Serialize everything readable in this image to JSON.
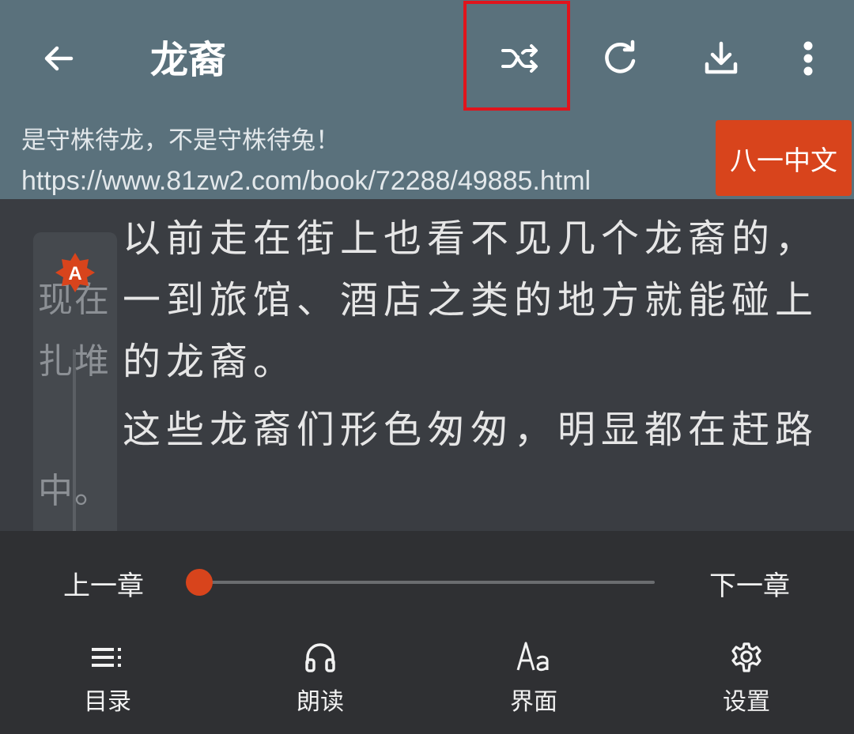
{
  "appbar": {
    "title": "龙裔",
    "back_icon": "arrow-left-icon",
    "actions": [
      "shuffle-icon",
      "refresh-icon",
      "download-icon",
      "more-vertical-icon"
    ]
  },
  "chapter": {
    "title": "是守株待龙，不是守株待兔！",
    "url": "https://www.81zw2.com/book/72288/49885.html",
    "source": "八一中文"
  },
  "reader": {
    "paragraphs": [
      "以前走在街上也看不见几个龙裔的，",
      "一到旅馆、酒店之类的地方就能碰上",
      "的龙裔。",
      "这些龙裔们形色匆匆，明显都在赶路"
    ],
    "side_lines": [
      "现在",
      "扎堆",
      "中。"
    ],
    "badge_letter": "A"
  },
  "progress": {
    "prev": "上一章",
    "next": "下一章",
    "value": 0
  },
  "menu": [
    {
      "label": "目录",
      "icon": "list-icon"
    },
    {
      "label": "朗读",
      "icon": "headphones-icon"
    },
    {
      "label": "界面",
      "icon": "font-icon"
    },
    {
      "label": "设置",
      "icon": "gear-icon"
    }
  ],
  "colors": {
    "appbar": "#5a717c",
    "accent": "#d8441c",
    "highlight": "#e0141c",
    "background": "#3a3d42",
    "menu": "#2f3033"
  }
}
